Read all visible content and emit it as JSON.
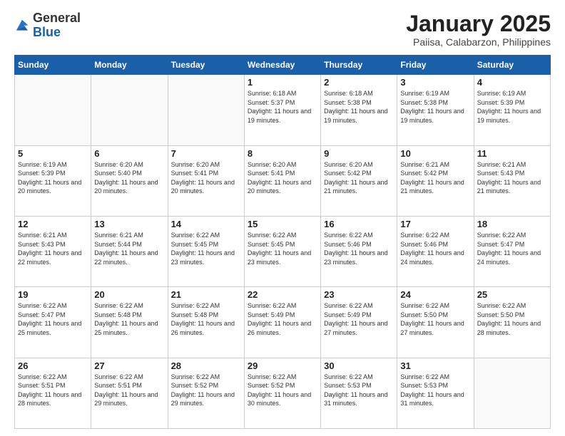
{
  "logo": {
    "general": "General",
    "blue": "Blue"
  },
  "title": "January 2025",
  "subtitle": "Paiisa, Calabarzon, Philippines",
  "days_of_week": [
    "Sunday",
    "Monday",
    "Tuesday",
    "Wednesday",
    "Thursday",
    "Friday",
    "Saturday"
  ],
  "weeks": [
    [
      {
        "day": "",
        "sunrise": "",
        "sunset": "",
        "daylight": ""
      },
      {
        "day": "",
        "sunrise": "",
        "sunset": "",
        "daylight": ""
      },
      {
        "day": "",
        "sunrise": "",
        "sunset": "",
        "daylight": ""
      },
      {
        "day": "1",
        "sunrise": "Sunrise: 6:18 AM",
        "sunset": "Sunset: 5:37 PM",
        "daylight": "Daylight: 11 hours and 19 minutes."
      },
      {
        "day": "2",
        "sunrise": "Sunrise: 6:18 AM",
        "sunset": "Sunset: 5:38 PM",
        "daylight": "Daylight: 11 hours and 19 minutes."
      },
      {
        "day": "3",
        "sunrise": "Sunrise: 6:19 AM",
        "sunset": "Sunset: 5:38 PM",
        "daylight": "Daylight: 11 hours and 19 minutes."
      },
      {
        "day": "4",
        "sunrise": "Sunrise: 6:19 AM",
        "sunset": "Sunset: 5:39 PM",
        "daylight": "Daylight: 11 hours and 19 minutes."
      }
    ],
    [
      {
        "day": "5",
        "sunrise": "Sunrise: 6:19 AM",
        "sunset": "Sunset: 5:39 PM",
        "daylight": "Daylight: 11 hours and 20 minutes."
      },
      {
        "day": "6",
        "sunrise": "Sunrise: 6:20 AM",
        "sunset": "Sunset: 5:40 PM",
        "daylight": "Daylight: 11 hours and 20 minutes."
      },
      {
        "day": "7",
        "sunrise": "Sunrise: 6:20 AM",
        "sunset": "Sunset: 5:41 PM",
        "daylight": "Daylight: 11 hours and 20 minutes."
      },
      {
        "day": "8",
        "sunrise": "Sunrise: 6:20 AM",
        "sunset": "Sunset: 5:41 PM",
        "daylight": "Daylight: 11 hours and 20 minutes."
      },
      {
        "day": "9",
        "sunrise": "Sunrise: 6:20 AM",
        "sunset": "Sunset: 5:42 PM",
        "daylight": "Daylight: 11 hours and 21 minutes."
      },
      {
        "day": "10",
        "sunrise": "Sunrise: 6:21 AM",
        "sunset": "Sunset: 5:42 PM",
        "daylight": "Daylight: 11 hours and 21 minutes."
      },
      {
        "day": "11",
        "sunrise": "Sunrise: 6:21 AM",
        "sunset": "Sunset: 5:43 PM",
        "daylight": "Daylight: 11 hours and 21 minutes."
      }
    ],
    [
      {
        "day": "12",
        "sunrise": "Sunrise: 6:21 AM",
        "sunset": "Sunset: 5:43 PM",
        "daylight": "Daylight: 11 hours and 22 minutes."
      },
      {
        "day": "13",
        "sunrise": "Sunrise: 6:21 AM",
        "sunset": "Sunset: 5:44 PM",
        "daylight": "Daylight: 11 hours and 22 minutes."
      },
      {
        "day": "14",
        "sunrise": "Sunrise: 6:22 AM",
        "sunset": "Sunset: 5:45 PM",
        "daylight": "Daylight: 11 hours and 23 minutes."
      },
      {
        "day": "15",
        "sunrise": "Sunrise: 6:22 AM",
        "sunset": "Sunset: 5:45 PM",
        "daylight": "Daylight: 11 hours and 23 minutes."
      },
      {
        "day": "16",
        "sunrise": "Sunrise: 6:22 AM",
        "sunset": "Sunset: 5:46 PM",
        "daylight": "Daylight: 11 hours and 23 minutes."
      },
      {
        "day": "17",
        "sunrise": "Sunrise: 6:22 AM",
        "sunset": "Sunset: 5:46 PM",
        "daylight": "Daylight: 11 hours and 24 minutes."
      },
      {
        "day": "18",
        "sunrise": "Sunrise: 6:22 AM",
        "sunset": "Sunset: 5:47 PM",
        "daylight": "Daylight: 11 hours and 24 minutes."
      }
    ],
    [
      {
        "day": "19",
        "sunrise": "Sunrise: 6:22 AM",
        "sunset": "Sunset: 5:47 PM",
        "daylight": "Daylight: 11 hours and 25 minutes."
      },
      {
        "day": "20",
        "sunrise": "Sunrise: 6:22 AM",
        "sunset": "Sunset: 5:48 PM",
        "daylight": "Daylight: 11 hours and 25 minutes."
      },
      {
        "day": "21",
        "sunrise": "Sunrise: 6:22 AM",
        "sunset": "Sunset: 5:48 PM",
        "daylight": "Daylight: 11 hours and 26 minutes."
      },
      {
        "day": "22",
        "sunrise": "Sunrise: 6:22 AM",
        "sunset": "Sunset: 5:49 PM",
        "daylight": "Daylight: 11 hours and 26 minutes."
      },
      {
        "day": "23",
        "sunrise": "Sunrise: 6:22 AM",
        "sunset": "Sunset: 5:49 PM",
        "daylight": "Daylight: 11 hours and 27 minutes."
      },
      {
        "day": "24",
        "sunrise": "Sunrise: 6:22 AM",
        "sunset": "Sunset: 5:50 PM",
        "daylight": "Daylight: 11 hours and 27 minutes."
      },
      {
        "day": "25",
        "sunrise": "Sunrise: 6:22 AM",
        "sunset": "Sunset: 5:50 PM",
        "daylight": "Daylight: 11 hours and 28 minutes."
      }
    ],
    [
      {
        "day": "26",
        "sunrise": "Sunrise: 6:22 AM",
        "sunset": "Sunset: 5:51 PM",
        "daylight": "Daylight: 11 hours and 28 minutes."
      },
      {
        "day": "27",
        "sunrise": "Sunrise: 6:22 AM",
        "sunset": "Sunset: 5:51 PM",
        "daylight": "Daylight: 11 hours and 29 minutes."
      },
      {
        "day": "28",
        "sunrise": "Sunrise: 6:22 AM",
        "sunset": "Sunset: 5:52 PM",
        "daylight": "Daylight: 11 hours and 29 minutes."
      },
      {
        "day": "29",
        "sunrise": "Sunrise: 6:22 AM",
        "sunset": "Sunset: 5:52 PM",
        "daylight": "Daylight: 11 hours and 30 minutes."
      },
      {
        "day": "30",
        "sunrise": "Sunrise: 6:22 AM",
        "sunset": "Sunset: 5:53 PM",
        "daylight": "Daylight: 11 hours and 31 minutes."
      },
      {
        "day": "31",
        "sunrise": "Sunrise: 6:22 AM",
        "sunset": "Sunset: 5:53 PM",
        "daylight": "Daylight: 11 hours and 31 minutes."
      },
      {
        "day": "",
        "sunrise": "",
        "sunset": "",
        "daylight": ""
      }
    ]
  ]
}
